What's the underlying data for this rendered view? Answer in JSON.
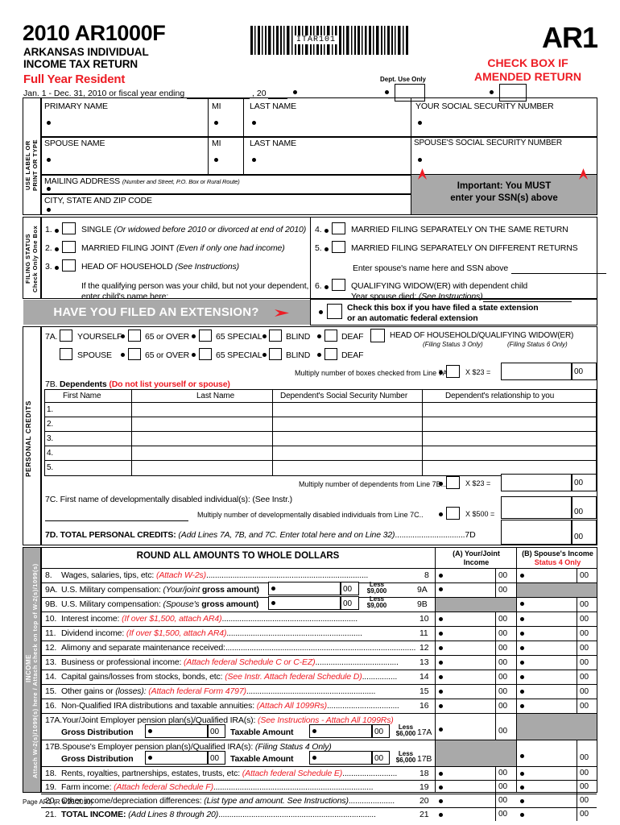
{
  "header": {
    "year_title": "2010 AR1000F",
    "subtitle_line1": "ARKANSAS INDIVIDUAL",
    "subtitle_line2": "INCOME TAX RETURN",
    "resident": "Full Year Resident",
    "period_prefix": "Jan. 1 - Dec. 31, 2010 or fiscal year ending",
    "period_comma": ", 20",
    "barcode_text": "ITAR101",
    "dept_use_only": "Dept. Use Only",
    "amended_line1": "CHECK BOX IF",
    "amended_line2": "AMENDED RETURN",
    "form_code": "AR1"
  },
  "name_block": {
    "side_label": "USE LABEL OR\nPRINT OR TYPE",
    "primary_name": "PRIMARY NAME",
    "mi": "MI",
    "last_name": "LAST NAME",
    "ssn": "YOUR SOCIAL SECURITY NUMBER",
    "spouse_name": "SPOUSE NAME",
    "mi2": "MI",
    "last_name2": "LAST NAME",
    "spouse_ssn": "SPOUSE'S SOCIAL SECURITY NUMBER",
    "mailing_address": "MAILING ADDRESS",
    "mailing_address_note": "(Number and Street, P.O. Box or Rural Route)",
    "city_state_zip": "CITY, STATE AND ZIP CODE",
    "important_line1": "Important: You MUST",
    "important_line2": "enter your SSN(s) above"
  },
  "filing_status": {
    "side_label": "FILING STATUS",
    "side_label2": "Check Only One Box",
    "options": [
      {
        "num": "1.",
        "label": "SINGLE ",
        "note": "(Or widowed before 2010 or divorced at end of 2010)"
      },
      {
        "num": "2.",
        "label": "MARRIED FILING JOINT ",
        "note": "(Even if only one had income)"
      },
      {
        "num": "3.",
        "label": "HEAD OF HOUSEHOLD ",
        "note": "(See Instructions)"
      },
      {
        "num": "4.",
        "label": "MARRIED FILING SEPARATELY ON THE SAME RETURN",
        "note": ""
      },
      {
        "num": "5.",
        "label": "MARRIED FILING SEPARATELY ON DIFFERENT RETURNS",
        "note": ""
      },
      {
        "num": "6.",
        "label": "QUALIFYING WIDOW(ER) with dependent child",
        "note": ""
      }
    ],
    "qualifying_child_note1": "If the qualifying person was your child, but not your dependent,",
    "qualifying_child_note2": "enter child's name here:",
    "spouse_name_note": "Enter spouse's name here and SSN above",
    "year_spouse_died": "Year spouse died: ",
    "year_spouse_died_note": "(See Instructions)",
    "extension_banner": "HAVE YOU FILED AN EXTENSION?",
    "extension_check1": "Check this box if you have filed a state extension",
    "extension_check2": "or an automatic federal extension"
  },
  "personal_credits": {
    "side_label": "PERSONAL CREDITS",
    "line7a_num": "7A.",
    "row1": [
      "YOURSELF",
      "65 or OVER",
      "65 SPECIAL",
      "BLIND",
      "DEAF"
    ],
    "row2": [
      "SPOUSE",
      "65 or OVER",
      "65 SPECIAL",
      "BLIND",
      "DEAF"
    ],
    "hoh_label": "HEAD OF HOUSEHOLD/QUALIFYING WIDOW(ER)",
    "hoh_note1": "(Filing Status 3 Only)",
    "hoh_note2": "(Filing Status 6 Only)",
    "multiply_7a": "Multiply number of boxes checked from Line 7A....",
    "x23": "X $23 =",
    "line7b_num": "7B.",
    "line7b_label": "Dependents ",
    "line7b_note": "(Do not list yourself or spouse)",
    "dep_headers": [
      "First Name",
      "Last Name",
      "Dependent's Social Security Number",
      "Dependent's relationship to you"
    ],
    "dep_rows": [
      "1.",
      "2.",
      "3.",
      "4.",
      "5."
    ],
    "multiply_7b": "Multiply number of dependents from Line 7B.....",
    "line7c": "7C. First name of developmentally disabled individual(s): (See Instr.)",
    "multiply_7c": "Multiply number of developmentally disabled individuals from Line 7C..",
    "x500": "X $500 =",
    "line7d_num": "7D.",
    "line7d_label": "TOTAL PERSONAL CREDITS:",
    "line7d_note": "(Add Lines 7A, 7B, and 7C.  Enter total here and on Line 32)",
    "line7d_dots": "................................",
    "line7d_ref": "7D",
    "cents": "00"
  },
  "income": {
    "side_label_main": "INCOME",
    "side_label_sub": "Attach W-2(s)/1099(s) here / Attach check on top of W-2(s)/1099(s)",
    "round_header": "ROUND ALL AMOUNTS TO WHOLE DOLLARS",
    "col_a_line1": "(A) Your/Joint",
    "col_a_line2": "Income",
    "col_b_line1": "(B) Spouse's Income",
    "col_b_line2": "Status 4 Only",
    "cents": "00",
    "less9000": "Less\n$9,000",
    "less6000": "Less\n$6,000",
    "gross_distribution": "Gross Distribution",
    "taxable_amount": "Taxable Amount",
    "lines": [
      {
        "num": "8.",
        "text": "Wages, salaries, tips, etc: ",
        "note": "(Attach W-2s)",
        "note_red": true,
        "ref": "8"
      },
      {
        "num": "9A.",
        "text": "U.S. Military compensation: ",
        "note": "(Your/joint",
        "note2": " gross amount)",
        "ref": "9A"
      },
      {
        "num": "9B.",
        "text": "U.S. Military compensation: ",
        "note": "(Spouse's",
        "note2": " gross amount)",
        "ref": "9B"
      },
      {
        "num": "10.",
        "text": "Interest income: ",
        "note": "(If over $1,500, attach AR4)",
        "note_red": true,
        "ref": "10"
      },
      {
        "num": "11.",
        "text": "Dividend income: ",
        "note": "(If over $1,500, attach AR4)",
        "note_red": true,
        "ref": "11"
      },
      {
        "num": "12.",
        "text": "Alimony and separate maintenance received:",
        "note": "",
        "ref": "12"
      },
      {
        "num": "13.",
        "text": "Business or professional income: ",
        "note": "(Attach federal Schedule C or C-EZ)",
        "note_red": true,
        "ref": "13"
      },
      {
        "num": "14.",
        "text": "Capital gains/losses from stocks, bonds, etc: ",
        "note": "(See Instr. Attach federal Schedule D)",
        "note_red": true,
        "ref": "14"
      },
      {
        "num": "15.",
        "text": "Other gains or ",
        "note": "(losses): ",
        "note2": "(Attach federal Form 4797)",
        "ref": "15"
      },
      {
        "num": "16.",
        "text": "Non-Qualified IRA distributions and taxable annuities: ",
        "note": "(Attach All 1099Rs)",
        "note_red": true,
        "ref": "16"
      },
      {
        "num": "17A.",
        "text": "Your/Joint Employer pension plan(s)/Qualified IRA(s): ",
        "note": "(See Instructions - Attach All 1099Rs)",
        "note_red": true,
        "ref": "17A"
      },
      {
        "num": "17B.",
        "text": "Spouse's Employer pension plan(s)/Qualified IRA(s): ",
        "note": "(Filing Status 4 Only)",
        "note_red": false,
        "ref": "17B"
      },
      {
        "num": "18.",
        "text": "Rents, royalties, partnerships, estates, trusts, etc: ",
        "note": "(Attach federal Schedule E)",
        "note_red": true,
        "ref": "18"
      },
      {
        "num": "19.",
        "text": "Farm income: ",
        "note": "(Attach federal Schedule F)",
        "note_red": true,
        "ref": "19"
      },
      {
        "num": "20.",
        "text": "Other income/depreciation differences: ",
        "note": "(List type and amount.  See Instructions)",
        "note_red": false,
        "ref": "20"
      },
      {
        "num": "21.",
        "text": "TOTAL INCOME: ",
        "note": "(Add Lines 8 through 20)",
        "note_red": false,
        "ref": "21",
        "bold": true
      }
    ]
  },
  "footer": {
    "page_label": "Page AR1 (R 8/26/2010)"
  },
  "colors": {
    "red": "#ed1c24",
    "grey": "#a9a9a9"
  }
}
